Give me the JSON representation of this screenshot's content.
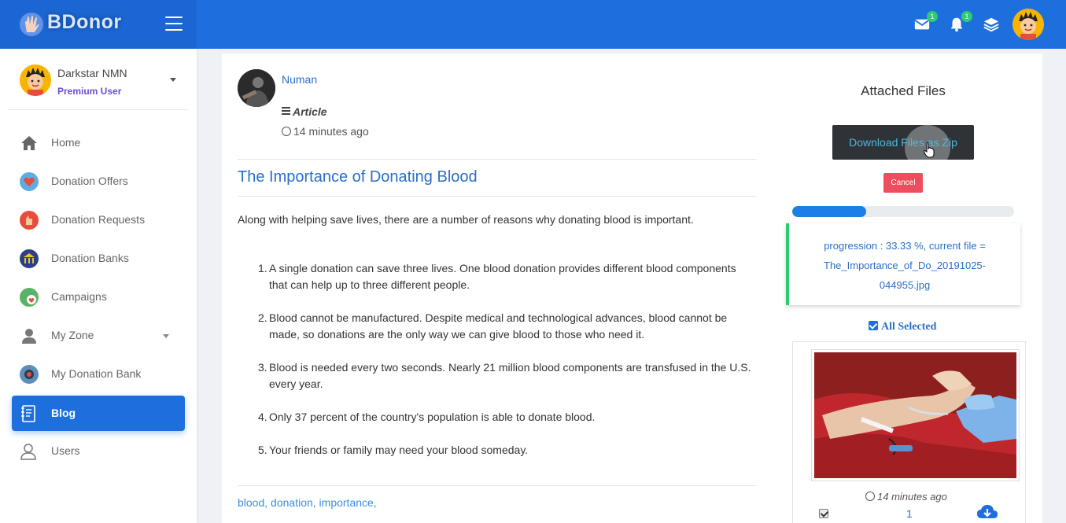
{
  "app": {
    "name": "BDonor"
  },
  "topbar": {
    "icons": [
      {
        "name": "mail-icon",
        "badge": "1"
      },
      {
        "name": "bell-icon",
        "badge": "1"
      },
      {
        "name": "layers-icon"
      },
      {
        "name": "avatar"
      }
    ]
  },
  "user": {
    "name": "Darkstar NMN",
    "role": "Premium User"
  },
  "sidebar": {
    "items": [
      {
        "label": "Home",
        "icon": "home-icon"
      },
      {
        "label": "Donation Offers",
        "icon": "donation-offers-icon"
      },
      {
        "label": "Donation Requests",
        "icon": "donation-requests-icon"
      },
      {
        "label": "Donation Banks",
        "icon": "donation-banks-icon"
      },
      {
        "label": "Campaigns",
        "icon": "campaigns-icon"
      },
      {
        "label": "My Zone",
        "icon": "user-icon"
      },
      {
        "label": "My Donation Bank",
        "icon": "my-donation-bank-icon"
      },
      {
        "label": "Blog",
        "icon": "blog-icon",
        "active": true
      },
      {
        "label": "Users",
        "icon": "users-icon"
      }
    ]
  },
  "post": {
    "author": "Numan",
    "type": "Article",
    "time": "14 minutes ago",
    "title": "The Importance of Donating Blood",
    "intro": "Along with helping save lives, there are a number of reasons why donating blood is important.",
    "points": [
      "A single donation can save three lives. One blood donation provides different blood components that can help up to three different people.",
      "Blood cannot be manufactured. Despite medical and technological advances, blood cannot be made, so donations are the only way we can give blood to those who need it.",
      "Blood is needed every two seconds. Nearly 21 million blood components are transfused in the U.S. every year.",
      "Only 37 percent of the country's population is able to donate blood.",
      "Your friends or family may need your blood someday."
    ],
    "tags": [
      "blood,",
      "donation,",
      "importance,"
    ]
  },
  "attachments": {
    "title": "Attached Files",
    "download_label": "Download Files as Zip",
    "cancel_label": "Cancel",
    "progress_percent": 33.33,
    "progress_line1": "progression : 33.33 %, current file =",
    "progress_line2": "The_Importance_of_Do_20191025-",
    "progress_line3": "044955.jpg",
    "all_selected": "All Selected",
    "file": {
      "time": "14 minutes ago",
      "number": "1"
    }
  },
  "colors": {
    "primary": "#1d6fde",
    "success": "#2ecc71",
    "danger": "#ef4d5d",
    "link": "#2a6fc8"
  }
}
